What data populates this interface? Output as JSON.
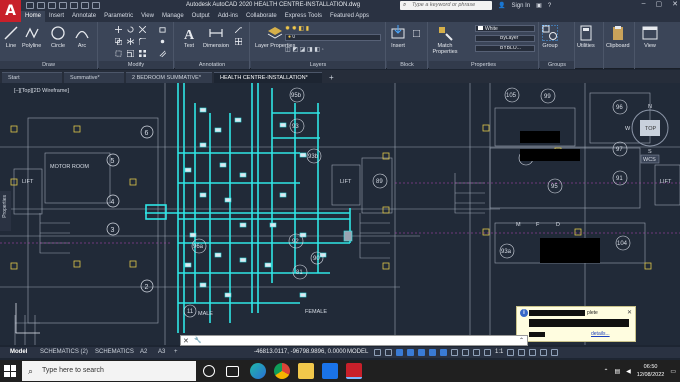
{
  "titlebar": {
    "app_logo": "A",
    "window_title": "Autodesk AutoCAD 2020   HEALTH CENTRE-INSTALLATION.dwg",
    "search_placeholder": "Type a keyword or phrase",
    "sign_in": "Sign In"
  },
  "ribbon_tabs": [
    "Home",
    "Insert",
    "Annotate",
    "Parametric",
    "View",
    "Manage",
    "Output",
    "Add-ins",
    "Collaborate",
    "Express Tools",
    "Featured Apps"
  ],
  "ribbon": {
    "draw": {
      "label": "Draw",
      "tools": [
        "Line",
        "Polyline",
        "Circle",
        "Arc"
      ]
    },
    "modify": {
      "label": "Modify"
    },
    "annotation": {
      "label": "Annotation",
      "tools": [
        "Text",
        "Dimension"
      ]
    },
    "layers": {
      "label": "Layers",
      "layer_properties": "Layer Properties",
      "current_layer": "0"
    },
    "block": {
      "label": "Block",
      "insert": "Insert"
    },
    "properties": {
      "label": "Properties",
      "match": "Match Properties",
      "color": "White",
      "linetype": "ByLayer",
      "lineweight": "BYBLO..."
    },
    "groups": {
      "label": "Groups",
      "group": "Group"
    },
    "utilities": "Utilities",
    "clipboard": "Clipboard",
    "view": "View"
  },
  "file_tabs": [
    {
      "label": "Start",
      "active": false
    },
    {
      "label": "Summative*",
      "active": false
    },
    {
      "label": "2 BEDROOM SUMMATIVE*",
      "active": false
    },
    {
      "label": "HEALTH CENTRE-INSTALLATION*",
      "active": true
    }
  ],
  "canvas": {
    "view_label": "[–][Top][2D Wireframe]",
    "properties_palette": "Properties",
    "viewcube": {
      "top": "TOP",
      "n": "N",
      "s": "S",
      "w": "W",
      "e": "E",
      "wcs": "WCS"
    },
    "grid_bubbles": [
      "6",
      "5",
      "4",
      "3",
      "2"
    ],
    "room_labels": {
      "lift_left": "LIFT",
      "motor_room": "MOTOR ROOM",
      "lift_center": "LIFT",
      "lift_right": "LIFT",
      "male": "MALE",
      "female": "FEMALE"
    },
    "room_numbers": [
      "95b",
      "93",
      "93b",
      "92",
      "89",
      "96a",
      "81",
      "90",
      "105",
      "99",
      "96",
      "97",
      "93",
      "91",
      "95",
      "93a",
      "93c",
      "104",
      "11"
    ],
    "col_letters": [
      "M",
      "F",
      "D"
    ]
  },
  "notification": {
    "text_end": "plete",
    "link": "details..."
  },
  "command_line": {
    "placeholder": "Type a command"
  },
  "status": {
    "layout_tabs": [
      "Model",
      "SCHEMATICS (2)",
      "SCHEMATICS",
      "A2",
      "A3"
    ],
    "coordinates": "-46813.0117, -96798.9896, 0.0000",
    "mode": "MODEL",
    "scale": "1:1"
  },
  "taskbar": {
    "search_placeholder": "Type here to search",
    "time": "06:50",
    "date": "12/08/2022"
  },
  "colors": {
    "ribbon_bg": "#3b4558",
    "canvas_bg": "#212a38",
    "pipe_cyan": "#2fe6e6",
    "accent_red": "#c8202a"
  }
}
